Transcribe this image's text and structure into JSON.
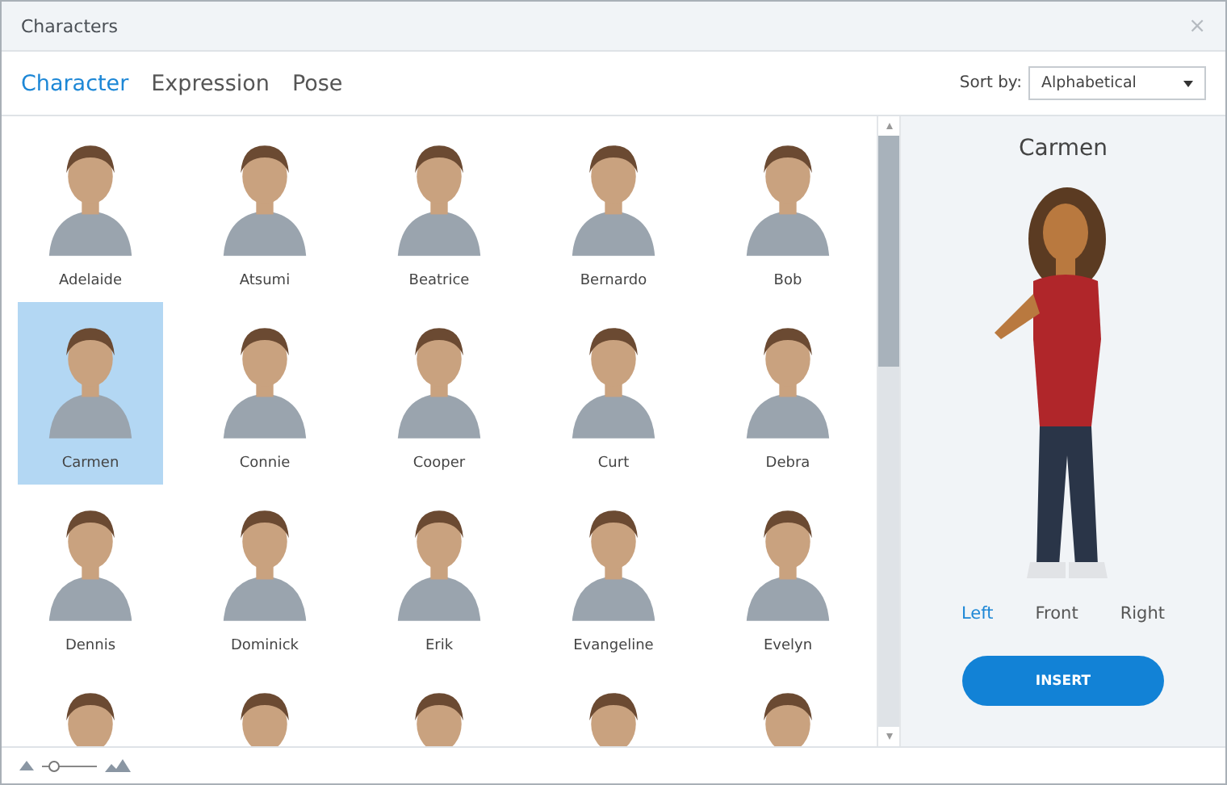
{
  "window": {
    "title": "Characters",
    "close": "×"
  },
  "tabs": [
    {
      "label": "Character",
      "selected": true
    },
    {
      "label": "Expression",
      "selected": false
    },
    {
      "label": "Pose",
      "selected": false
    }
  ],
  "sort": {
    "label": "Sort by:",
    "value": "Alphabetical"
  },
  "characters": [
    {
      "name": "Adelaide",
      "selected": false
    },
    {
      "name": "Atsumi",
      "selected": false
    },
    {
      "name": "Beatrice",
      "selected": false
    },
    {
      "name": "Bernardo",
      "selected": false
    },
    {
      "name": "Bob",
      "selected": false
    },
    {
      "name": "Carmen",
      "selected": true
    },
    {
      "name": "Connie",
      "selected": false
    },
    {
      "name": "Cooper",
      "selected": false
    },
    {
      "name": "Curt",
      "selected": false
    },
    {
      "name": "Debra",
      "selected": false
    },
    {
      "name": "Dennis",
      "selected": false
    },
    {
      "name": "Dominick",
      "selected": false
    },
    {
      "name": "Erik",
      "selected": false
    },
    {
      "name": "Evangeline",
      "selected": false
    },
    {
      "name": "Evelyn",
      "selected": false
    },
    {
      "selected": false
    },
    {
      "selected": false
    },
    {
      "selected": false
    },
    {
      "selected": false
    },
    {
      "selected": false
    }
  ],
  "preview": {
    "name": "Carmen",
    "views": [
      {
        "label": "Left",
        "selected": true
      },
      {
        "label": "Front",
        "selected": false
      },
      {
        "label": "Right",
        "selected": false
      }
    ],
    "button": "INSERT"
  },
  "size_slider": {
    "level": 0.2
  }
}
